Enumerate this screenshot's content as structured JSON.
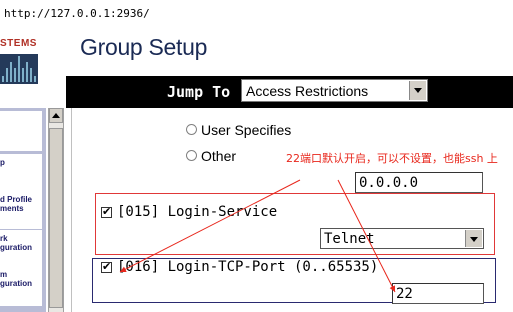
{
  "browser": {
    "url": "http://127.0.0.1:2936/"
  },
  "logo": {
    "text": "STEMS"
  },
  "page": {
    "title": "Group Setup"
  },
  "jump": {
    "label": "Jump To",
    "selected": "Access Restrictions"
  },
  "sidebar": {
    "items": [
      {
        "line1": "",
        "line2": ""
      },
      {
        "line1": "p",
        "line2": ""
      },
      {
        "line1": "d Profile",
        "line2": "ments"
      },
      {
        "line1": "rk",
        "line2": "guration"
      },
      {
        "line1": "m",
        "line2": "guration"
      }
    ]
  },
  "form": {
    "radio_user_specifies": "User Specifies",
    "radio_other": "Other",
    "other_value": "0.0.0.0",
    "login_service_label": "[015] Login-Service",
    "login_service_value": "Telnet",
    "login_tcp_port_label": "[016] Login-TCP-Port (0..65535)",
    "login_tcp_port_value": "22"
  },
  "annotation": {
    "text": "22端口默认开启，可以不设置，也能ssh 上",
    "color": "#e8271c"
  },
  "colors": {
    "title": "#1a2a54",
    "jumpbar": "#000000",
    "sidebar": "#b8bcd6",
    "logo_text": "#b03025",
    "red_highlight": "#e03838",
    "blue_highlight": "#2a2a70"
  }
}
